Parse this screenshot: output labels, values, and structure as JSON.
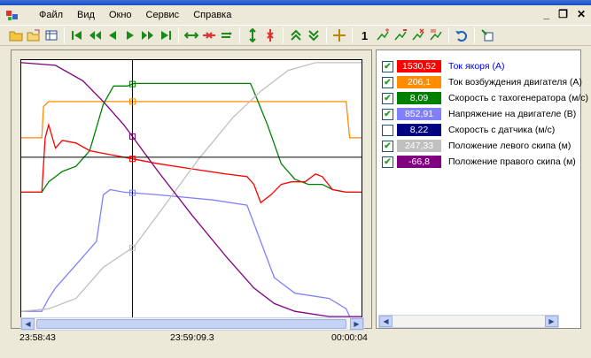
{
  "menu": {
    "items": [
      "Файл",
      "Вид",
      "Окно",
      "Сервис",
      "Справка"
    ]
  },
  "window_controls": {
    "minimize": "_",
    "restore": "❐",
    "close": "✕"
  },
  "toolbar": {
    "icons": [
      "open-folder-icon",
      "open-file-icon",
      "table-icon",
      "go-first-icon",
      "rewind-icon",
      "step-back-icon",
      "play-icon",
      "fast-forward-icon",
      "go-last-icon",
      "zoom-in-horizontal-icon",
      "zoom-out-horizontal-icon",
      "zoom-fit-horizontal-icon",
      "zoom-in-vertical-icon",
      "zoom-out-vertical-icon",
      "scale-up-icon",
      "scale-down-icon",
      "cursor-cross-icon",
      "marker-add-icon",
      "marker-remove-icon",
      "marker-clear-icon",
      "marker-list-icon",
      "undo-icon",
      "export-icon"
    ],
    "number_label": "1"
  },
  "time_axis": {
    "start": "23:58:43",
    "cursor": "23:59:09.3",
    "span": "00:00:04"
  },
  "legend": [
    {
      "checked": true,
      "value": "1530,52",
      "label": "Ток якоря (А)",
      "color": "#ff0000",
      "text_color": "#ffffff",
      "label_color": "#0000ff"
    },
    {
      "checked": true,
      "value": "206,1",
      "label": "Ток возбуждения двигателя (А)",
      "color": "#ff8c00",
      "text_color": "#ffffff",
      "label_color": "#000000"
    },
    {
      "checked": true,
      "value": "8,09",
      "label": "Скорость с тахогенератора (м/с)",
      "color": "#008000",
      "text_color": "#ffffff",
      "label_color": "#000000"
    },
    {
      "checked": true,
      "value": "852,91",
      "label": "Напряжение на двигателе (В)",
      "color": "#8080ff",
      "text_color": "#ffffff",
      "label_color": "#000000"
    },
    {
      "checked": false,
      "value": "8,22",
      "label": "Скорость с датчика (м/с)",
      "color": "#000080",
      "text_color": "#ffffff",
      "label_color": "#000000"
    },
    {
      "checked": true,
      "value": "247,33",
      "label": "Положение левого скипа (м)",
      "color": "#c0c0c0",
      "text_color": "#ffffff",
      "label_color": "#000000"
    },
    {
      "checked": true,
      "value": "-66,8",
      "label": "Положение правого скипа (м)",
      "color": "#800080",
      "text_color": "#ffffff",
      "label_color": "#000000"
    }
  ],
  "chart_data": {
    "type": "line",
    "grid": false,
    "cursor_x": 0.325,
    "series": [
      {
        "color": "#ff8c00",
        "values": [
          [
            0,
            0.3
          ],
          [
            0.06,
            0.3
          ],
          [
            0.065,
            0.18
          ],
          [
            0.08,
            0.16
          ],
          [
            0.9,
            0.16
          ],
          [
            0.95,
            0.16
          ],
          [
            0.96,
            0.3
          ],
          [
            1,
            0.3
          ]
        ]
      },
      {
        "color": "#008000",
        "values": [
          [
            0,
            0.51
          ],
          [
            0.06,
            0.51
          ],
          [
            0.08,
            0.47
          ],
          [
            0.12,
            0.43
          ],
          [
            0.16,
            0.41
          ],
          [
            0.2,
            0.35
          ],
          [
            0.24,
            0.17
          ],
          [
            0.27,
            0.1
          ],
          [
            0.31,
            0.1
          ],
          [
            0.33,
            0.09
          ],
          [
            0.5,
            0.09
          ],
          [
            0.67,
            0.09
          ],
          [
            0.68,
            0.12
          ],
          [
            0.72,
            0.25
          ],
          [
            0.76,
            0.4
          ],
          [
            0.8,
            0.46
          ],
          [
            0.84,
            0.48
          ],
          [
            0.88,
            0.48
          ],
          [
            0.91,
            0.5
          ],
          [
            0.95,
            0.51
          ],
          [
            1,
            0.51
          ]
        ]
      },
      {
        "color": "#ff0000",
        "values": [
          [
            0,
            0.51
          ],
          [
            0.06,
            0.51
          ],
          [
            0.07,
            0.3
          ],
          [
            0.08,
            0.25
          ],
          [
            0.1,
            0.34
          ],
          [
            0.12,
            0.31
          ],
          [
            0.16,
            0.32
          ],
          [
            0.2,
            0.35
          ],
          [
            0.24,
            0.36
          ],
          [
            0.28,
            0.37
          ],
          [
            0.32,
            0.38
          ],
          [
            0.4,
            0.4
          ],
          [
            0.5,
            0.42
          ],
          [
            0.6,
            0.44
          ],
          [
            0.66,
            0.45
          ],
          [
            0.68,
            0.48
          ],
          [
            0.7,
            0.55
          ],
          [
            0.73,
            0.52
          ],
          [
            0.76,
            0.48
          ],
          [
            0.79,
            0.47
          ],
          [
            0.83,
            0.47
          ],
          [
            0.86,
            0.44
          ],
          [
            0.88,
            0.45
          ],
          [
            0.91,
            0.5
          ],
          [
            0.95,
            0.51
          ],
          [
            1,
            0.51
          ]
        ]
      },
      {
        "color": "#8080ff",
        "values": [
          [
            0,
            0.97
          ],
          [
            0.06,
            0.97
          ],
          [
            0.08,
            0.92
          ],
          [
            0.1,
            0.88
          ],
          [
            0.14,
            0.82
          ],
          [
            0.18,
            0.76
          ],
          [
            0.22,
            0.7
          ],
          [
            0.24,
            0.52
          ],
          [
            0.26,
            0.5
          ],
          [
            0.3,
            0.51
          ],
          [
            0.4,
            0.52
          ],
          [
            0.56,
            0.54
          ],
          [
            0.66,
            0.56
          ],
          [
            0.7,
            0.7
          ],
          [
            0.74,
            0.84
          ],
          [
            0.8,
            0.9
          ],
          [
            0.9,
            0.92
          ],
          [
            0.95,
            0.96
          ],
          [
            0.96,
            0.99
          ],
          [
            1,
            0.99
          ]
        ]
      },
      {
        "color": "#c0c0c0",
        "values": [
          [
            0,
            0.97
          ],
          [
            0.08,
            0.96
          ],
          [
            0.16,
            0.92
          ],
          [
            0.24,
            0.8
          ],
          [
            0.33,
            0.72
          ],
          [
            0.42,
            0.56
          ],
          [
            0.52,
            0.38
          ],
          [
            0.62,
            0.22
          ],
          [
            0.7,
            0.12
          ],
          [
            0.78,
            0.04
          ],
          [
            0.86,
            0.01
          ],
          [
            1,
            0.01
          ]
        ]
      },
      {
        "color": "#800080",
        "values": [
          [
            0,
            0.01
          ],
          [
            0.1,
            0.02
          ],
          [
            0.18,
            0.08
          ],
          [
            0.24,
            0.16
          ],
          [
            0.3,
            0.25
          ],
          [
            0.4,
            0.43
          ],
          [
            0.5,
            0.6
          ],
          [
            0.6,
            0.76
          ],
          [
            0.68,
            0.88
          ],
          [
            0.74,
            0.94
          ],
          [
            0.8,
            0.97
          ],
          [
            0.9,
            0.99
          ],
          [
            1,
            0.99
          ]
        ]
      }
    ],
    "hline_y": 0.375
  }
}
